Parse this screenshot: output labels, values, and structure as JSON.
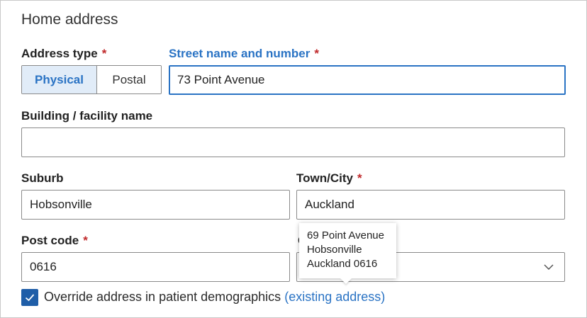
{
  "section": {
    "title": "Home address"
  },
  "required_marker": "*",
  "address_type": {
    "label": "Address type",
    "options": [
      "Physical",
      "Postal"
    ],
    "selected": "Physical"
  },
  "street": {
    "label": "Street name and number",
    "value": "73 Point Avenue"
  },
  "building": {
    "label": "Building / facility name",
    "value": ""
  },
  "suburb": {
    "label": "Suburb",
    "value": "Hobsonville"
  },
  "town_city": {
    "label": "Town/City",
    "value": "Auckland"
  },
  "post_code": {
    "label": "Post code",
    "value": "0616"
  },
  "country": {
    "label_partial": "C",
    "value": ""
  },
  "tooltip": {
    "line1": "69 Point Avenue",
    "line2": "Hobsonville",
    "line3": "Auckland 0616"
  },
  "override": {
    "checked": true,
    "label": "Override address in patient demographics",
    "link": "(existing address)"
  },
  "icons": {
    "checkbox": "check-icon",
    "select": "chevron-down-icon"
  },
  "colors": {
    "accent": "#2a73c4",
    "required": "#c0292b",
    "checkbox": "#1f5ea8",
    "segment_active_bg": "#e1ecf8"
  }
}
